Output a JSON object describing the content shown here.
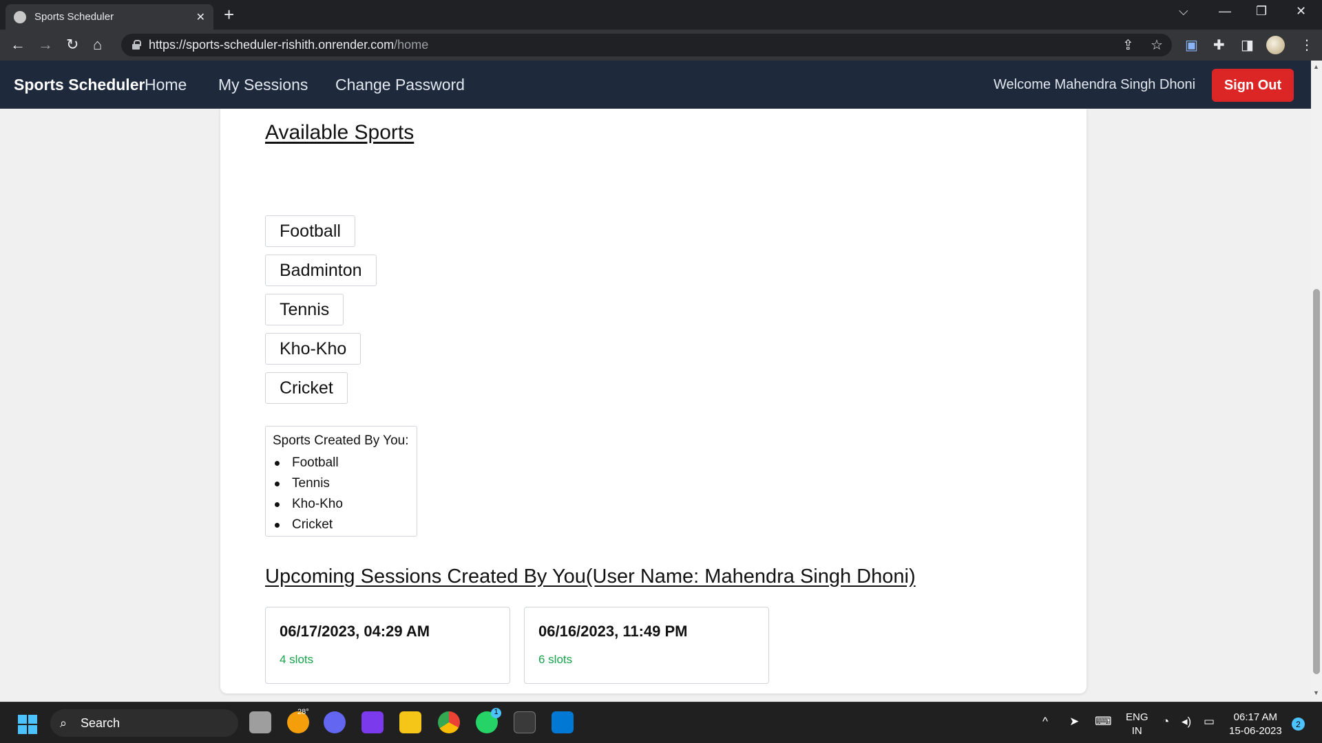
{
  "browser": {
    "tab_title": "Sports Scheduler",
    "url_host": "https://sports-scheduler-rishith.onrender.com",
    "url_path": "/home"
  },
  "app": {
    "brand": "Sports Scheduler",
    "nav": [
      "Home",
      "My Sessions",
      "Change Password"
    ],
    "welcome": "Welcome Mahendra Singh Dhoni",
    "signout_label": "Sign Out"
  },
  "available_sports": {
    "heading": "Available Sports",
    "items": [
      "Football",
      "Badminton",
      "Tennis",
      "Kho-Kho",
      "Cricket"
    ]
  },
  "created_sports": {
    "label": "Sports Created By You:",
    "items": [
      "Football",
      "Tennis",
      "Kho-Kho",
      "Cricket"
    ]
  },
  "upcoming": {
    "heading": "Upcoming Sessions Created By You(User Name: Mahendra Singh Dhoni)",
    "sessions": [
      {
        "datetime": "06/17/2023, 04:29 AM",
        "slots": "4 slots"
      },
      {
        "datetime": "06/16/2023, 11:49 PM",
        "slots": "6 slots"
      }
    ]
  },
  "taskbar": {
    "search_label": "Search",
    "weather_badge": "28°",
    "whatsapp_badge": "1",
    "lang_line1": "ENG",
    "lang_line2": "IN",
    "time": "06:17 AM",
    "date": "15-06-2023",
    "notification_count": "2"
  },
  "colors": {
    "navbar": "#1e293b",
    "signout": "#dc2626",
    "slots": "#16a34a"
  }
}
